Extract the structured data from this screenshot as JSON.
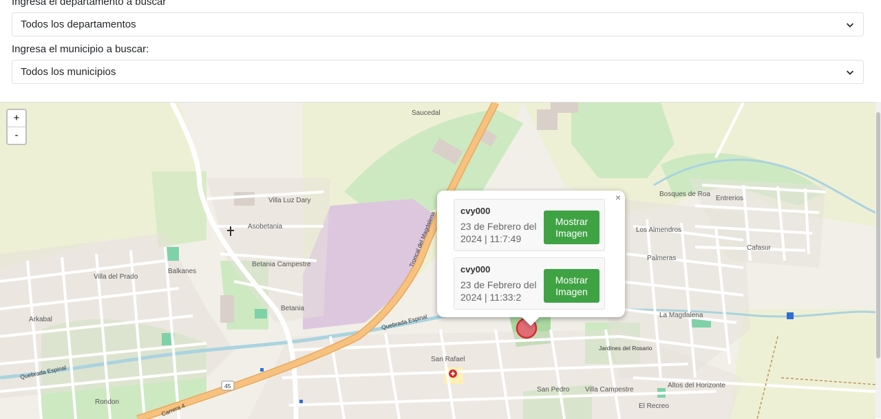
{
  "filters": {
    "department_label": "Ingresa el departamento a buscar",
    "department_selected": "Todos los departamentos",
    "municipality_label": "Ingresa el municipio a buscar:",
    "municipality_selected": "Todos los municipios"
  },
  "map": {
    "zoom_in": "+",
    "zoom_out": "-",
    "labels": {
      "saucedal": "Saucedal",
      "villa_luz_dary": "Villa Luz Dary",
      "asobetania": "Asobetania",
      "betania_campestre": "Betania Campestre",
      "betania": "Betania",
      "balkanes": "Balkanes",
      "villa_del_prado": "Villa del Prado",
      "arkabal": "Arkabal",
      "rondon": "Rondon",
      "san_rafael": "San Rafael",
      "san_pedro": "San Pedro",
      "villa_campestre": "Villa Campestre",
      "altos_del_horizonte": "Altos del Horizonte",
      "el_recreo": "El Recreo",
      "la_magdalena": "La Magdalena",
      "los_almendros": "Los Almendros",
      "bosques_de_roa": "Bosques de Roa",
      "entre_rios": "Entrerios",
      "cafasur": "Cafasur",
      "jardines_del_rosario": "Jardines del Rosario",
      "palmeras": "Palmeras",
      "troncal": "Troncal del Magdalena",
      "quebrada": "Quebrada Espinal",
      "route": "45",
      "carrera_4": "Carrera 4"
    }
  },
  "popup": {
    "close": "×",
    "records": [
      {
        "name": "cvy000",
        "date": "23 de Febrero del 2024 | 11:7:49",
        "button": "Mostrar Imagen"
      },
      {
        "name": "cvy000",
        "date": "23 de Febrero del 2024 | 11:33:2",
        "button": "Mostrar Imagen"
      }
    ]
  },
  "colors": {
    "button_green": "#3fa344",
    "marker_red": "#e06c75",
    "road_orange": "#f7c27f",
    "park_green": "#cde9c1",
    "industrial_pink": "#dcc7df",
    "river_blue": "#aad3df"
  },
  "icons": {
    "select_chevron": "chevron-down-icon",
    "close": "close-icon",
    "marker": "map-marker-icon"
  }
}
